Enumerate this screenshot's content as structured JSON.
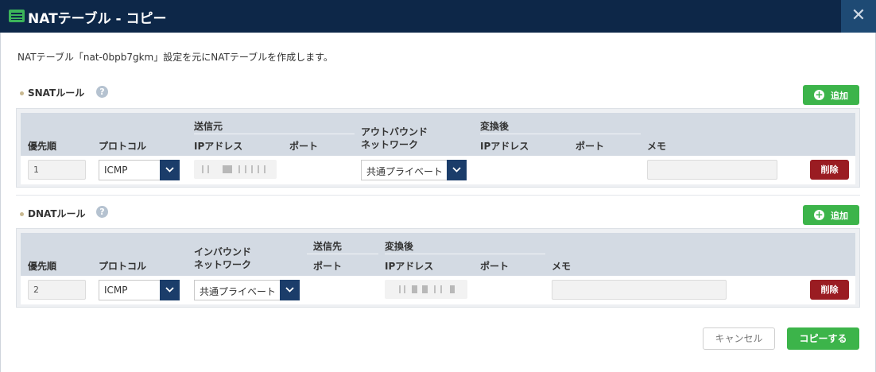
{
  "title": "NATテーブル - コピー",
  "description": "NATテーブル「nat-0bpb7gkm」設定を元にNATテーブルを作成します。",
  "snat": {
    "title": "SNATルール",
    "add_label": "追加",
    "headers": {
      "priority": "優先順",
      "protocol": "プロトコル",
      "source": "送信元",
      "source_ip": "IPアドレス",
      "source_port": "ポート",
      "outbound_network_1": "アウトバウンド",
      "outbound_network_2": "ネットワーク",
      "translated": "変換後",
      "translated_ip": "IPアドレス",
      "translated_port": "ポート",
      "memo": "メモ"
    },
    "rows": [
      {
        "priority": "1",
        "protocol": "ICMP",
        "network": "共通プライベート",
        "memo": "",
        "delete_label": "削除"
      }
    ]
  },
  "dnat": {
    "title": "DNATルール",
    "add_label": "追加",
    "headers": {
      "priority": "優先順",
      "protocol": "プロトコル",
      "inbound_network_1": "インバウンド",
      "inbound_network_2": "ネットワーク",
      "destination": "送信先",
      "destination_port": "ポート",
      "translated": "変換後",
      "translated_ip": "IPアドレス",
      "translated_port": "ポート",
      "memo": "メモ"
    },
    "rows": [
      {
        "priority": "2",
        "protocol": "ICMP",
        "network": "共通プライベート",
        "memo": "",
        "delete_label": "削除"
      }
    ]
  },
  "footer": {
    "cancel_label": "キャンセル",
    "copy_label": "コピーする"
  },
  "icons": {
    "title": "nat-table-icon",
    "close": "close-icon",
    "help": "help-icon",
    "add": "plus-circle-icon",
    "dropdown": "chevron-down-icon"
  },
  "colors": {
    "titlebar": "#0d2748",
    "accent_green": "#3cb44a",
    "delete_red": "#9a1c22",
    "select_arrow": "#1b3d6a"
  }
}
